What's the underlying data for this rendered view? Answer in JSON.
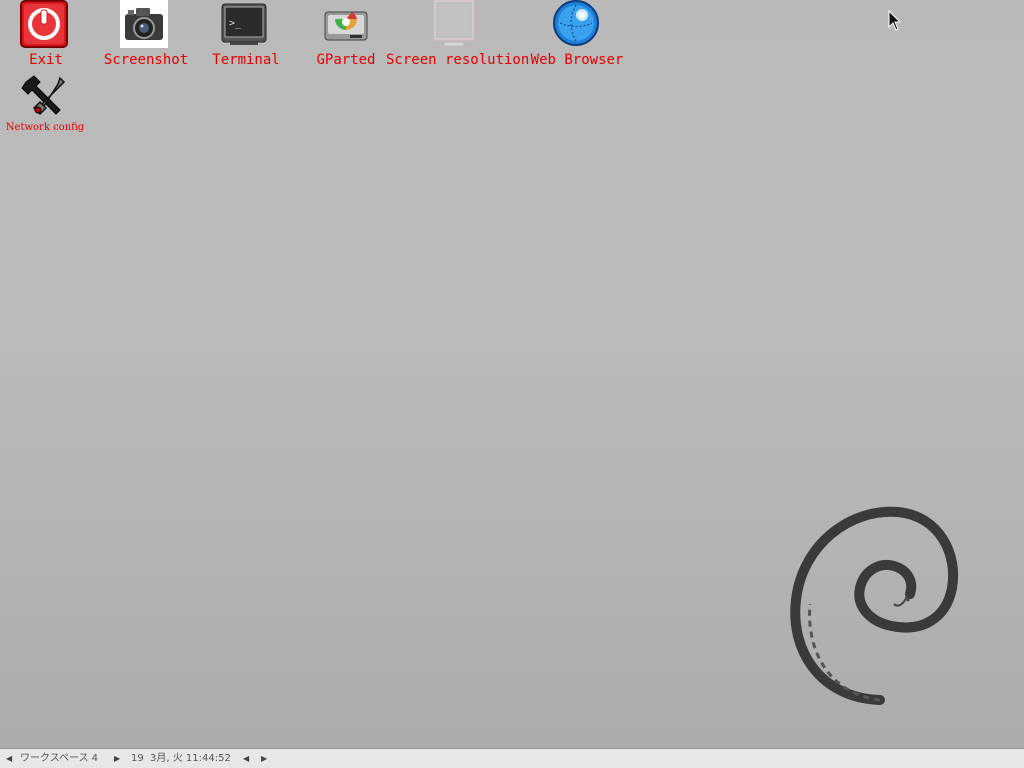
{
  "desktop": {
    "icons": [
      {
        "label": "Exit",
        "icon": "power-icon"
      },
      {
        "label": "Screenshot",
        "icon": "camera-icon"
      },
      {
        "label": "Terminal",
        "icon": "terminal-icon"
      },
      {
        "label": "GParted",
        "icon": "disk-icon"
      },
      {
        "label": "Screen resolution",
        "icon": "monitor-icon"
      },
      {
        "label": "Web Browser",
        "icon": "globe-icon"
      },
      {
        "label": "Network config",
        "icon": "tools-icon"
      }
    ],
    "label_color": "#e60000"
  },
  "taskbar": {
    "workspace_label": "ワークスペース 4",
    "date_day": "19",
    "date_rest": "3月, 火 11:44:52",
    "prev_arrow": "◀",
    "next_arrow": "▶"
  },
  "branding": {
    "logo": "debian-swirl"
  }
}
